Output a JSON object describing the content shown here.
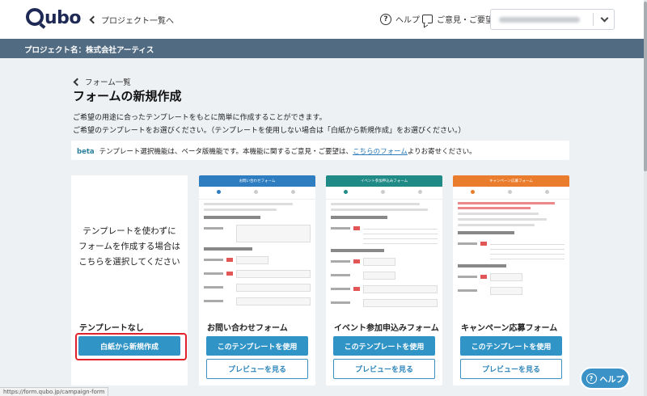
{
  "header": {
    "logo_text": "ubo",
    "back_to_projects": "プロジェクト一覧へ",
    "help": "ヘルプ",
    "feedback": "ご意見・ご要望"
  },
  "project_bar": {
    "label": "プロジェクト名：株式会社アーティス"
  },
  "main": {
    "back_link": "フォーム一覧",
    "title": "フォームの新規作成",
    "desc_line1": "ご希望の用途に合ったテンプレートをもとに簡単に作成することができます。",
    "desc_line2": "ご希望のテンプレートをお選びください。（テンプレートを使用しない場合は「白紙から新規作成」をお選びください。）",
    "notice": {
      "badge": "beta",
      "text_before": "テンプレート選択機能は、ベータ版機能です。本機能に関するご意見・ご要望は、",
      "link": "こちらのフォーム",
      "text_after": "よりお寄せください。"
    }
  },
  "cards": {
    "blank": {
      "line1": "テンプレートを使わずに",
      "line2": "フォームを作成する場合は",
      "line3": "こちらを選択してください",
      "label": "テンプレートなし",
      "button": "白紙から新規作成"
    },
    "contact": {
      "preview_title": "お問い合わせフォーム",
      "label": "お問い合わせフォーム",
      "use_button": "このテンプレートを使用",
      "preview_button": "プレビューを見る",
      "color": "#2f7dc1"
    },
    "event": {
      "preview_title": "イベント参加申込みフォーム",
      "label": "イベント参加申込みフォーム",
      "use_button": "このテンプレートを使用",
      "preview_button": "プレビューを見る",
      "color": "#1f8a86"
    },
    "campaign": {
      "preview_title": "キャンペーン応募フォーム",
      "label": "キャンペーン応募フォーム",
      "use_button": "このテンプレートを使用",
      "preview_button": "プレビューを見る",
      "color": "#ea7d2d"
    }
  },
  "help_fab": {
    "label": "ヘルプ"
  },
  "status_url": "https://form.qubo.jp/campaign-form"
}
